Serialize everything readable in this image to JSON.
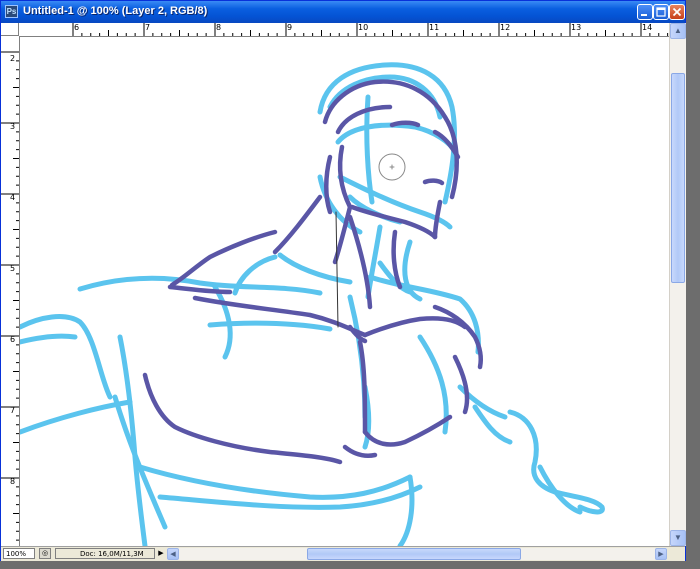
{
  "window": {
    "title": "Untitled-1 @ 100% (Layer 2, RGB/8)",
    "app_icon": "Ps"
  },
  "rulers": {
    "top": [
      "6",
      "7",
      "8",
      "9",
      "10",
      "11",
      "12",
      "13",
      "14"
    ],
    "left": [
      "2",
      "3",
      "4",
      "5",
      "6",
      "7",
      "8"
    ]
  },
  "statusbar": {
    "zoom": "100%",
    "doc_info": "Doc: 16,0M/11,3M"
  },
  "icons": {
    "app": "photoshop-icon",
    "minimize": "minimize-icon",
    "maximize": "maximize-icon",
    "close": "close-icon"
  },
  "colors": {
    "sketch_light": "#5bc4ee",
    "sketch_dark": "#5a56a6",
    "titlebar": "#0a5fe0"
  }
}
